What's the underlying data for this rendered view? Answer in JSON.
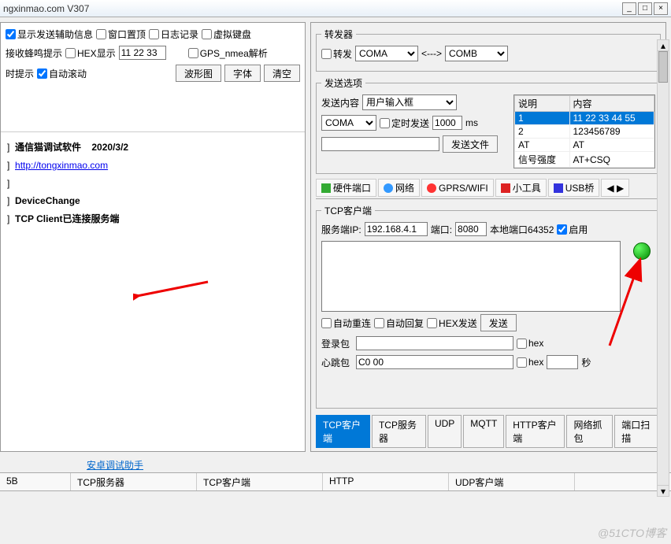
{
  "window": {
    "title": "ngxinmao.com  V307"
  },
  "left": {
    "chk_show_aux": "显示发送辅助信息",
    "chk_topmost": "窗口置顶",
    "chk_log": "日志记录",
    "chk_vkbd": "虚拟键盘",
    "lbl_beep": "接收蜂鸣提示",
    "chk_hex": "HEX显示",
    "hex_val": "11 22 33",
    "chk_gps": "GPS_nmea解析",
    "lbl_rt": "时提示",
    "chk_autoscroll": "自动滚动",
    "btn_wave": "波形图",
    "btn_font": "字体",
    "btn_clear": "清空",
    "log": {
      "line1_a": "通信猫调试软件",
      "line1_b": "2020/3/2",
      "line2": "http://tongxinmao.com",
      "line3": "DeviceChange",
      "line4": "TCP Client已连接服务端"
    },
    "android_link": "安卓调试助手"
  },
  "right": {
    "forward": {
      "legend": "转发器",
      "chk": "转发",
      "comA": "COMA",
      "arrows": "<--->",
      "comB": "COMB"
    },
    "sendopt": {
      "legend": "发送选项",
      "lbl_content": "发送内容",
      "sel_content": "用户输入框",
      "comA": "COMA",
      "chk_timer": "定时发送",
      "timer_val": "1000",
      "ms": "ms",
      "btn_sendfile": "发送文件",
      "table": {
        "h1": "说明",
        "h2": "内容",
        "rows": [
          {
            "a": "1",
            "b": "11 22 33 44 55"
          },
          {
            "a": "2",
            "b": "123456789"
          },
          {
            "a": "AT",
            "b": "AT"
          },
          {
            "a": "信号强度",
            "b": "AT+CSQ"
          }
        ]
      }
    },
    "tabs1": {
      "t1": "硬件端口",
      "t2": "网络",
      "t3": "GPRS/WIFI",
      "t4": "小工具",
      "t5": "USB桥"
    },
    "tcp": {
      "legend": "TCP客户端",
      "lbl_ip": "服务端IP:",
      "ip": "192.168.4.1",
      "lbl_port": "端口:",
      "port": "8080",
      "lbl_localport": "本地端口64352",
      "chk_enable": "启用",
      "chk_reconn": "自动重连",
      "chk_autoreply": "自动回复",
      "chk_hexsend": "HEX发送",
      "btn_send": "发送",
      "lbl_login": "登录包",
      "chk_hex1": "hex",
      "lbl_heart": "心跳包",
      "heart_val": "C0 00",
      "chk_hex2": "hex",
      "lbl_sec": "秒"
    },
    "tabs2": {
      "t1": "TCP客户端",
      "t2": "TCP服务器",
      "t3": "UDP",
      "t4": "MQTT",
      "t5": "HTTP客户端",
      "t6": "网络抓包",
      "t7": "端口扫描"
    }
  },
  "bottom": {
    "t1": "5B",
    "t2": "TCP服务器",
    "t3": "TCP客户端",
    "t4": "HTTP",
    "t5": "UDP客户端"
  },
  "watermark": "@51CTO博客"
}
